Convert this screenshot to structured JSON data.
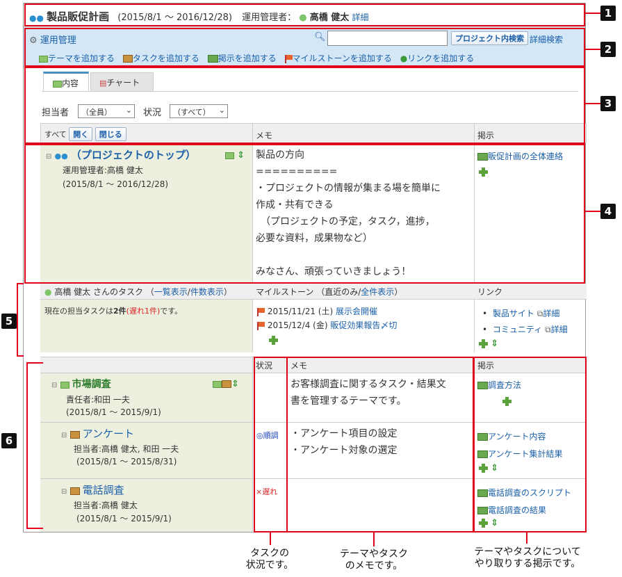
{
  "header": {
    "title": "製品販促計画",
    "period": "(2015/8/1 ～ 2016/12/28)",
    "manager_label": "運用管理者：",
    "manager_name": "高橋 健太",
    "detail": "詳細"
  },
  "toolbar": {
    "admin": "運用管理",
    "search_button": "プロジェクト内検索",
    "advanced_search": "詳細検索",
    "search_placeholder": "",
    "actions": [
      "テーマを追加する",
      "タスクを追加する",
      "掲示を追加する",
      "マイルストーンを追加する",
      "リンクを追加する"
    ]
  },
  "tabs": {
    "content": "内容",
    "chart": "チャート"
  },
  "filters": {
    "assignee_label": "担当者",
    "assignee_value": "（全員）",
    "status_label": "状況",
    "status_value": "（すべて）"
  },
  "table1": {
    "all": "すべて",
    "open": "開く",
    "close": "閉じる",
    "memo": "メモ",
    "notice": "掲示"
  },
  "top": {
    "title": "（プロジェクトのトップ）",
    "manager": "運用管理者:高橋 健太",
    "period": "(2015/8/1 ～ 2016/12/28)",
    "memo": [
      "製品の方向",
      "==========",
      "・プロジェクトの情報が集まる場を簡単に",
      "作成・共有できる",
      "　（プロジェクトの予定，タスク，進捗，",
      "必要な資料，成果物など）",
      "",
      "みなさん、頑張っていきましょう！"
    ],
    "notice": "販促計画の全体連絡"
  },
  "tasks": {
    "header_user": "高橋 健太 さんのタスク",
    "list_link": "一覧表示",
    "count_link": "件数表示",
    "summary_pre": "現在の担当タスクは",
    "summary_count": "2件",
    "summary_late": "(遅れ1件)",
    "summary_post": "です。"
  },
  "milestones": {
    "header": "マイルストーン （直近のみ/",
    "all_link": "全件表示",
    "header_end": "）",
    "items": [
      {
        "date": "2015/11/21 (土)",
        "name": "展示会開催"
      },
      {
        "date": "2015/12/4 (金)",
        "name": "販促効果報告〆切"
      }
    ]
  },
  "links": {
    "header": "リンク",
    "items": [
      {
        "name": "製品サイト",
        "detail": "詳細"
      },
      {
        "name": "コミュニティ",
        "detail": "詳細"
      }
    ]
  },
  "table2": {
    "status": "状況",
    "memo": "メモ",
    "notice": "掲示"
  },
  "themes": [
    {
      "title": "市場調査",
      "person": "責任者:和田 一夫",
      "period": "(2015/8/1 ～ 2015/9/1)",
      "status": "",
      "memo": [
        "お客様調査に関するタスク・結果文",
        "書を管理するテーマです。"
      ],
      "notices": [
        "調査方法"
      ]
    },
    {
      "title": "アンケート",
      "person": "担当者:高橋 健太, 和田 一夫",
      "period": "(2015/8/1 ～ 2015/8/31)",
      "status": "◎順調",
      "memo": [
        "・アンケート項目の設定",
        "・アンケート対象の選定"
      ],
      "notices": [
        "アンケート内容",
        "アンケート集計結果"
      ]
    },
    {
      "title": "電話調査",
      "person": "担当者:高橋 健太",
      "period": "(2015/8/1 ～ 2015/9/1)",
      "status": "×遅れ",
      "memo": [],
      "notices": [
        "電話調査のスクリプト",
        "電話調査の結果"
      ]
    }
  ],
  "callouts": [
    "1",
    "2",
    "3",
    "4",
    "5",
    "6"
  ],
  "captions": {
    "status": "タスクの\n状況です。",
    "memo": "テーマやタスク\nのメモです。",
    "notice": "テーマやタスクについて\nやり取りする掲示です。"
  },
  "colors": {
    "accent": "#1a5fa8",
    "highlight": "#e0001a",
    "late": "#e02020",
    "ok": "#1a3fb8"
  }
}
